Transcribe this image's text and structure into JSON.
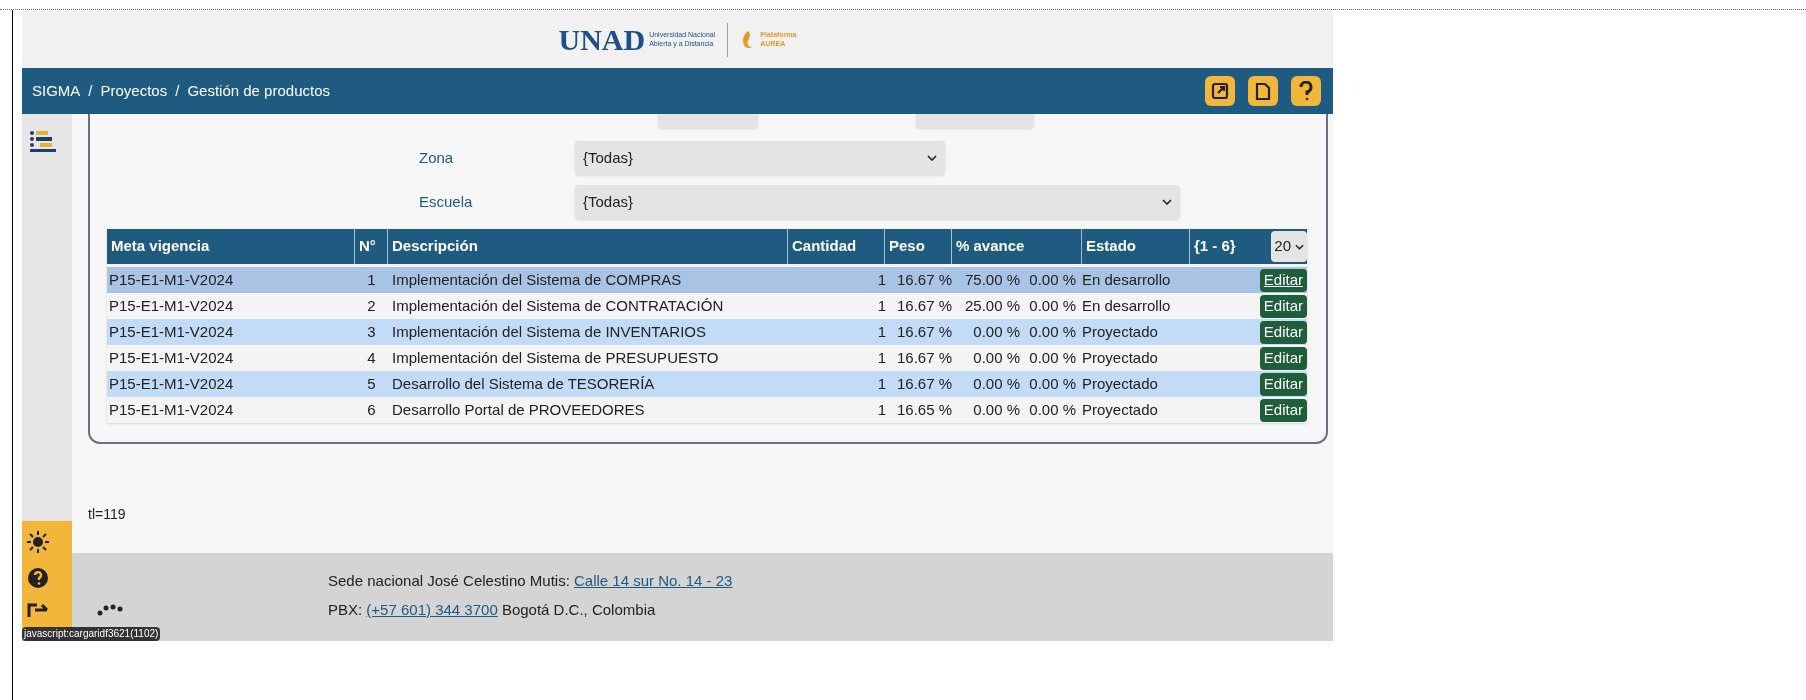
{
  "header": {
    "logo_text": "UNAD",
    "logo_subtitle": [
      "Universidad Nacional",
      "Abierta y a Distancia"
    ],
    "platform": [
      "Plataforma",
      "AUREA"
    ]
  },
  "breadcrumb": [
    "SIGMA",
    "Proyectos",
    "Gestión de productos"
  ],
  "breadcrumb_separator": "/",
  "filters": [
    {
      "label": "Zona",
      "value": "{Todas}",
      "kind": "short"
    },
    {
      "label": "Escuela",
      "value": "{Todas}",
      "kind": "long"
    }
  ],
  "table": {
    "columns": [
      "Meta vigencia",
      "N°",
      "Descripción",
      "Cantidad",
      "Peso",
      "% avance",
      "Estado"
    ],
    "range": "{1 - 6}",
    "page_size": "20",
    "rows": [
      {
        "meta": "P15-E1-M1-V2024",
        "n": "1",
        "descripcion": "Implementación del Sistema de COMPRAS",
        "cantidad": "1",
        "peso": "16.67 %",
        "avance": "75.00 %",
        "column_8": "0.00 %",
        "estado": "En desarrollo",
        "action": "Editar",
        "hovered": true
      },
      {
        "meta": "P15-E1-M1-V2024",
        "n": "2",
        "descripcion": "Implementación del Sistema de CONTRATACIÓN",
        "cantidad": "1",
        "peso": "16.67 %",
        "avance": "25.00 %",
        "column_8": "0.00 %",
        "estado": "En desarrollo",
        "action": "Editar",
        "hovered": false
      },
      {
        "meta": "P15-E1-M1-V2024",
        "n": "3",
        "descripcion": "Implementación del Sistema de INVENTARIOS",
        "cantidad": "1",
        "peso": "16.67 %",
        "avance": "0.00 %",
        "column_8": "0.00 %",
        "estado": "Proyectado",
        "action": "Editar",
        "hovered": false
      },
      {
        "meta": "P15-E1-M1-V2024",
        "n": "4",
        "descripcion": "Implementación del Sistema de PRESUPUESTO",
        "cantidad": "1",
        "peso": "16.67 %",
        "avance": "0.00 %",
        "column_8": "0.00 %",
        "estado": "Proyectado",
        "action": "Editar",
        "hovered": false
      },
      {
        "meta": "P15-E1-M1-V2024",
        "n": "5",
        "descripcion": "Desarrollo del Sistema de TESORERÍA",
        "cantidad": "1",
        "peso": "16.67 %",
        "avance": "0.00 %",
        "column_8": "0.00 %",
        "estado": "Proyectado",
        "action": "Editar",
        "hovered": false
      },
      {
        "meta": "P15-E1-M1-V2024",
        "n": "6",
        "descripcion": "Desarrollo Portal de PROVEEDORES",
        "cantidad": "1",
        "peso": "16.65 %",
        "avance": "0.00 %",
        "column_8": "0.00 %",
        "estado": "Proyectado",
        "action": "Editar",
        "hovered": false
      }
    ]
  },
  "debug_text": "tl=119",
  "footer": [
    {
      "label": "Sede nacional José Celestino Mutis: ",
      "link": "Calle 14 sur No. 14 - 23"
    },
    {
      "label": "PBX: ",
      "link": "(+57 601) 344 3700",
      "after": " Bogotá D.C., Colombia"
    }
  ],
  "status_tooltip": "javascript:cargaridf3621(1102)"
}
